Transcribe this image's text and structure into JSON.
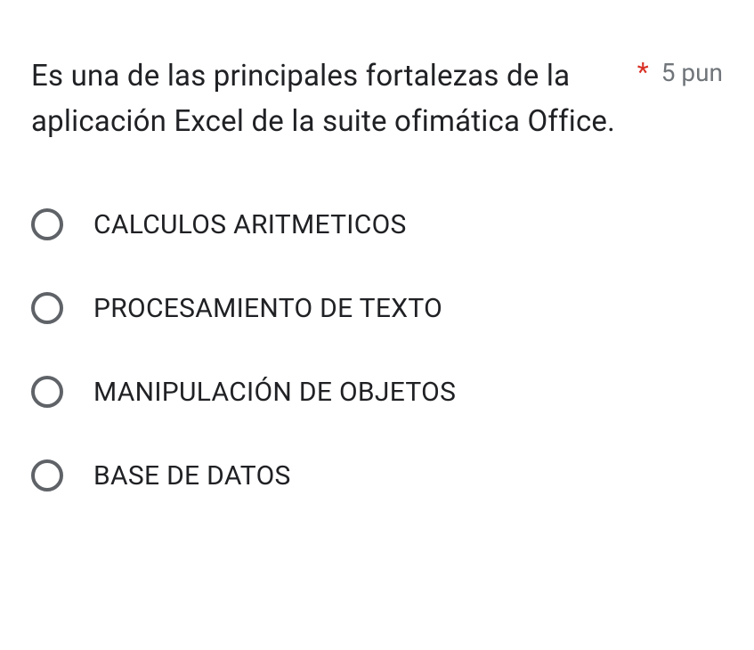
{
  "question": {
    "text": "Es una de las principales fortalezas de la aplicación Excel de la suite ofimática Office.",
    "required_marker": "*",
    "points_label": "5 pun"
  },
  "options": [
    {
      "label": "CALCULOS ARITMETICOS"
    },
    {
      "label": "PROCESAMIENTO DE TEXTO"
    },
    {
      "label": "MANIPULACIÓN DE OBJETOS"
    },
    {
      "label": "BASE DE DATOS"
    }
  ]
}
